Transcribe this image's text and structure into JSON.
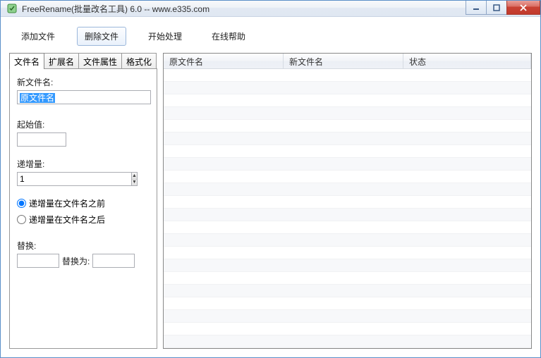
{
  "window": {
    "title": "FreeRename(批量改名工具) 6.0    --   www.e335.com"
  },
  "toolbar": {
    "add": "添加文件",
    "delete": "删除文件",
    "process": "开始处理",
    "help": "在线帮助"
  },
  "tabs": {
    "t0": "文件名",
    "t1": "扩展名",
    "t2": "文件属性",
    "t3": "格式化"
  },
  "form": {
    "newname_label": "新文件名:",
    "newname_value": "原文件名",
    "start_label": "起始值:",
    "start_value": "",
    "inc_label": "递增量:",
    "inc_value": "1",
    "radio_before": "递增量在文件名之前",
    "radio_after": "递增量在文件名之后",
    "radio_selected": "before",
    "replace_label": "替换:",
    "replace_from": "",
    "replace_mid": "替换为:",
    "replace_to": ""
  },
  "grid": {
    "col1": "原文件名",
    "col2": "新文件名",
    "col3": "状态",
    "rows": []
  }
}
